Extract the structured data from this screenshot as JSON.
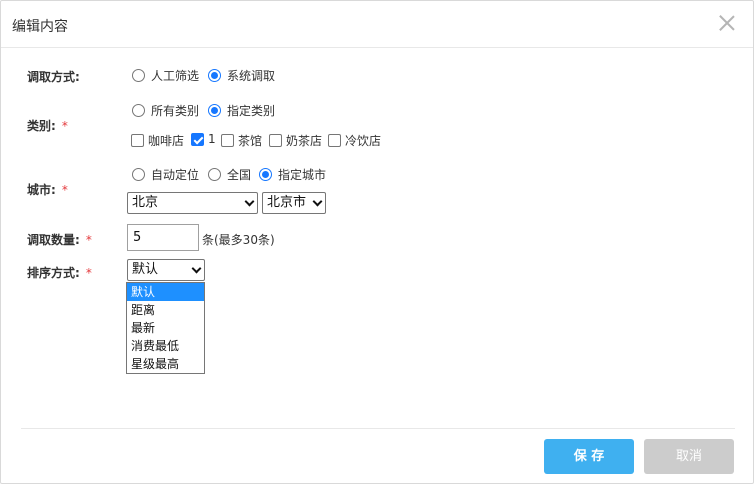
{
  "dialog": {
    "title": "编辑内容"
  },
  "method": {
    "label": "调取方式:",
    "options": [
      {
        "label": "人工筛选",
        "checked": false
      },
      {
        "label": "系统调取",
        "checked": true
      }
    ]
  },
  "category": {
    "label": "类别:",
    "required_mark": "*",
    "scope_options": [
      {
        "label": "所有类别",
        "checked": false
      },
      {
        "label": "指定类别",
        "checked": true
      }
    ],
    "items": [
      {
        "label": "咖啡店",
        "checked": false
      },
      {
        "label": "1",
        "checked": true
      },
      {
        "label": "茶馆",
        "checked": false
      },
      {
        "label": "奶茶店",
        "checked": false
      },
      {
        "label": "冷饮店",
        "checked": false
      }
    ]
  },
  "city": {
    "label": "城市:",
    "required_mark": "*",
    "options": [
      {
        "label": "自动定位",
        "checked": false
      },
      {
        "label": "全国",
        "checked": false
      },
      {
        "label": "指定城市",
        "checked": true
      }
    ],
    "province_value": "北京",
    "city_value": "北京市"
  },
  "count": {
    "label": "调取数量:",
    "required_mark": "*",
    "value": "5",
    "hint": "条(最多30条)"
  },
  "sort": {
    "label": "排序方式:",
    "required_mark": "*",
    "selected": "默认",
    "options": [
      "默认",
      "距离",
      "最新",
      "消费最低",
      "星级最高"
    ]
  },
  "footer": {
    "save_label": "保 存",
    "cancel_label": "取消"
  },
  "colors": {
    "primary": "#3fb0f0",
    "radio_accent": "#1677ff",
    "required": "#e4393c",
    "dropdown_highlight": "#1e90ff"
  }
}
